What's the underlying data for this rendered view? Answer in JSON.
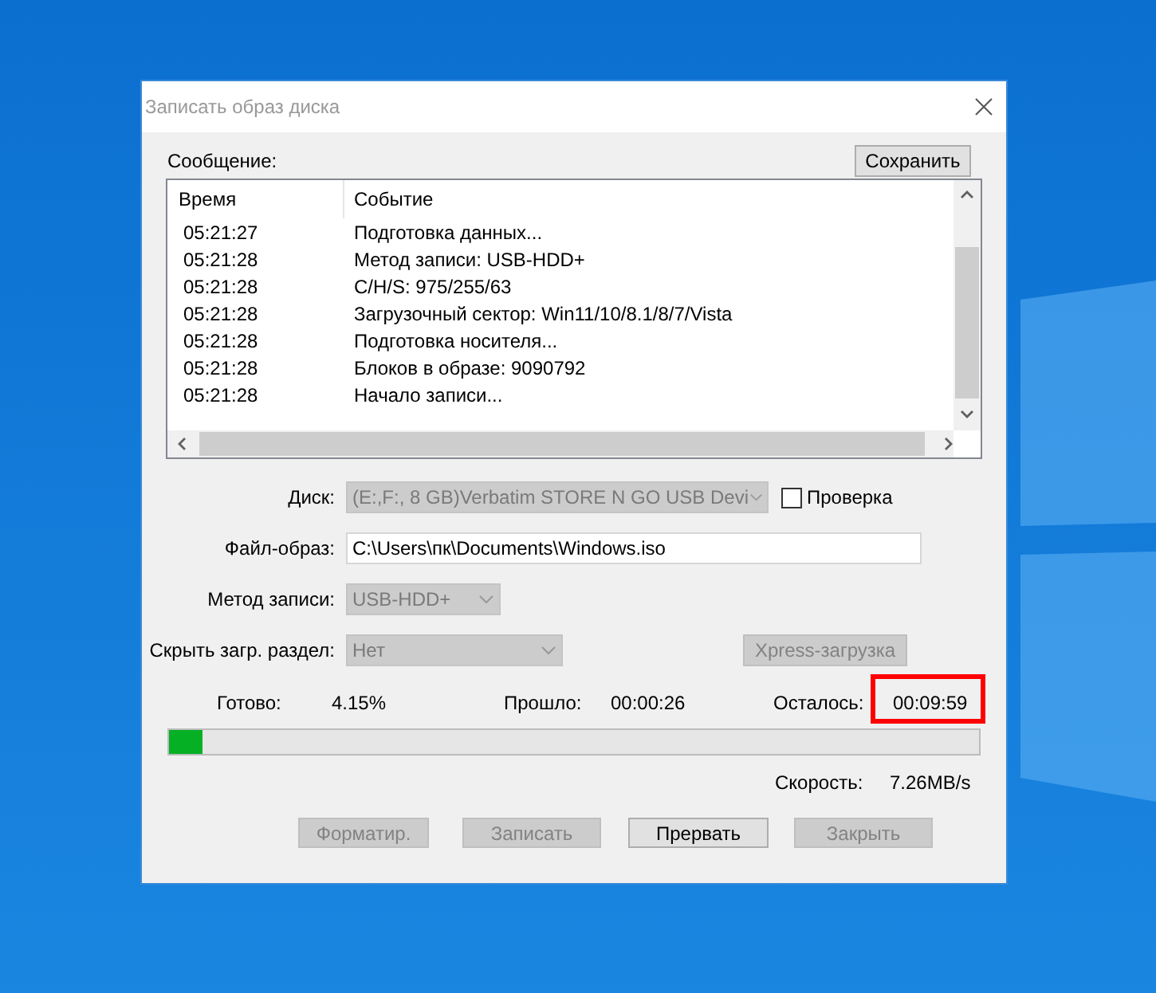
{
  "window": {
    "title": "Записать образ диска"
  },
  "messages": {
    "label": "Сообщение:",
    "save_button": "Сохранить",
    "columns": [
      "Время",
      "Событие"
    ],
    "rows": [
      {
        "time": "05:21:27",
        "event": "Подготовка данных..."
      },
      {
        "time": "05:21:28",
        "event": "Метод записи: USB-HDD+"
      },
      {
        "time": "05:21:28",
        "event": "C/H/S: 975/255/63"
      },
      {
        "time": "05:21:28",
        "event": "Загрузочный сектор: Win11/10/8.1/8/7/Vista"
      },
      {
        "time": "05:21:28",
        "event": "Подготовка носителя..."
      },
      {
        "time": "05:21:28",
        "event": "Блоков в образе: 9090792"
      },
      {
        "time": "05:21:28",
        "event": "Начало записи..."
      }
    ]
  },
  "form": {
    "disk": {
      "label": "Диск:",
      "value": "(E:,F:, 8 GB)Verbatim STORE N GO USB Devi",
      "disabled": true
    },
    "verify": {
      "label": "Проверка",
      "checked": false
    },
    "file": {
      "label": "Файл-образ:",
      "value": "C:\\Users\\пк\\Documents\\Windows.iso"
    },
    "method": {
      "label": "Метод записи:",
      "value": "USB-HDD+",
      "disabled": true
    },
    "hide": {
      "label": "Скрыть загр. раздел:",
      "value": "Нет",
      "disabled": true
    },
    "xpress_button": {
      "label": "Xpress-загрузка",
      "disabled": true
    }
  },
  "status": [
    {
      "label": "Готово:",
      "value": "4.15%",
      "highlighted": false
    },
    {
      "label": "Прошло:",
      "value": "00:00:26",
      "highlighted": false
    },
    {
      "label": "Осталось:",
      "value": "00:09:59",
      "highlighted": true
    }
  ],
  "progress": {
    "level": 0.0415
  },
  "speed": {
    "label": "Скорость:",
    "value": "7.26MB/s"
  },
  "buttons": [
    {
      "label": "Форматир.",
      "disabled": true
    },
    {
      "label": "Записать",
      "disabled": true
    },
    {
      "label": "Прервать",
      "disabled": false
    },
    {
      "label": "Закрыть",
      "disabled": true
    }
  ]
}
